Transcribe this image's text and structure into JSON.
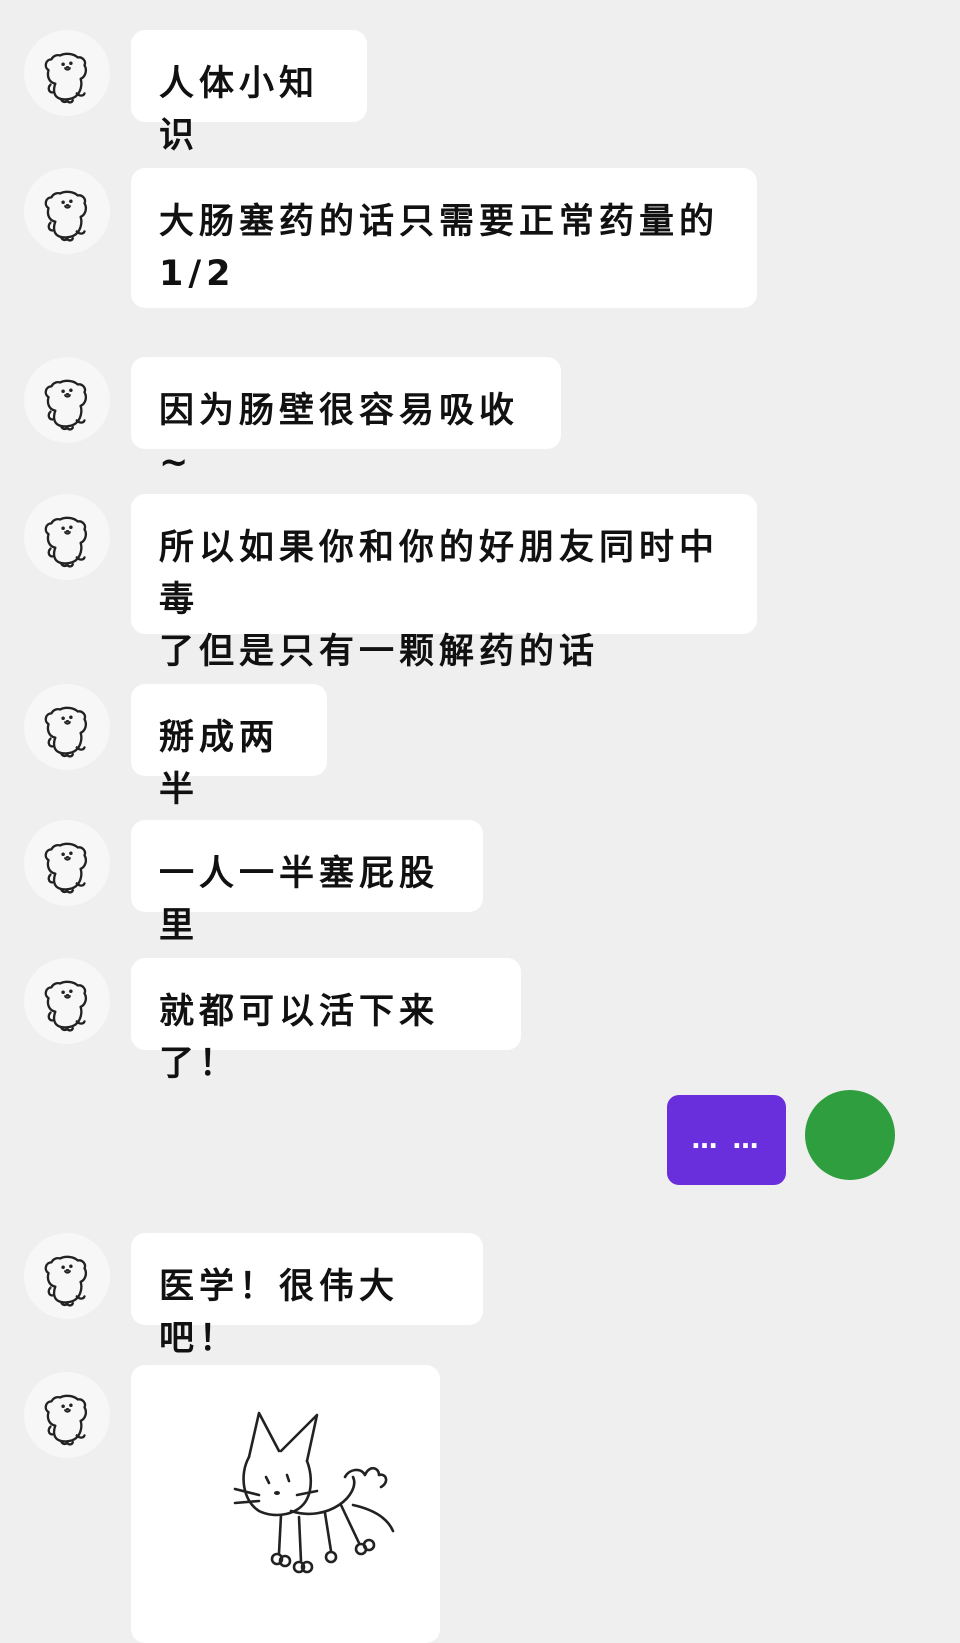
{
  "messages": [
    {
      "text": "人体小知识"
    },
    {
      "text": "大肠塞药的话只需要正常药量的\n1/2"
    },
    {
      "text": "因为肠壁很容易吸收~"
    },
    {
      "text": "所以如果你和你的好朋友同时中毒\n了但是只有一颗解药的话"
    },
    {
      "text": "掰成两半"
    },
    {
      "text": "一人一半塞屁股里"
    },
    {
      "text": "就都可以活下来了！"
    },
    {
      "text": "医学！很伟大吧！"
    }
  ],
  "own_message": {
    "text": "… …",
    "bubble_color": "#6a2fdc",
    "avatar_color": "#2e9e3f"
  },
  "sticker": {
    "icon": "cat-sticker-icon"
  },
  "avatar": {
    "icon": "dog-avatar-icon"
  }
}
